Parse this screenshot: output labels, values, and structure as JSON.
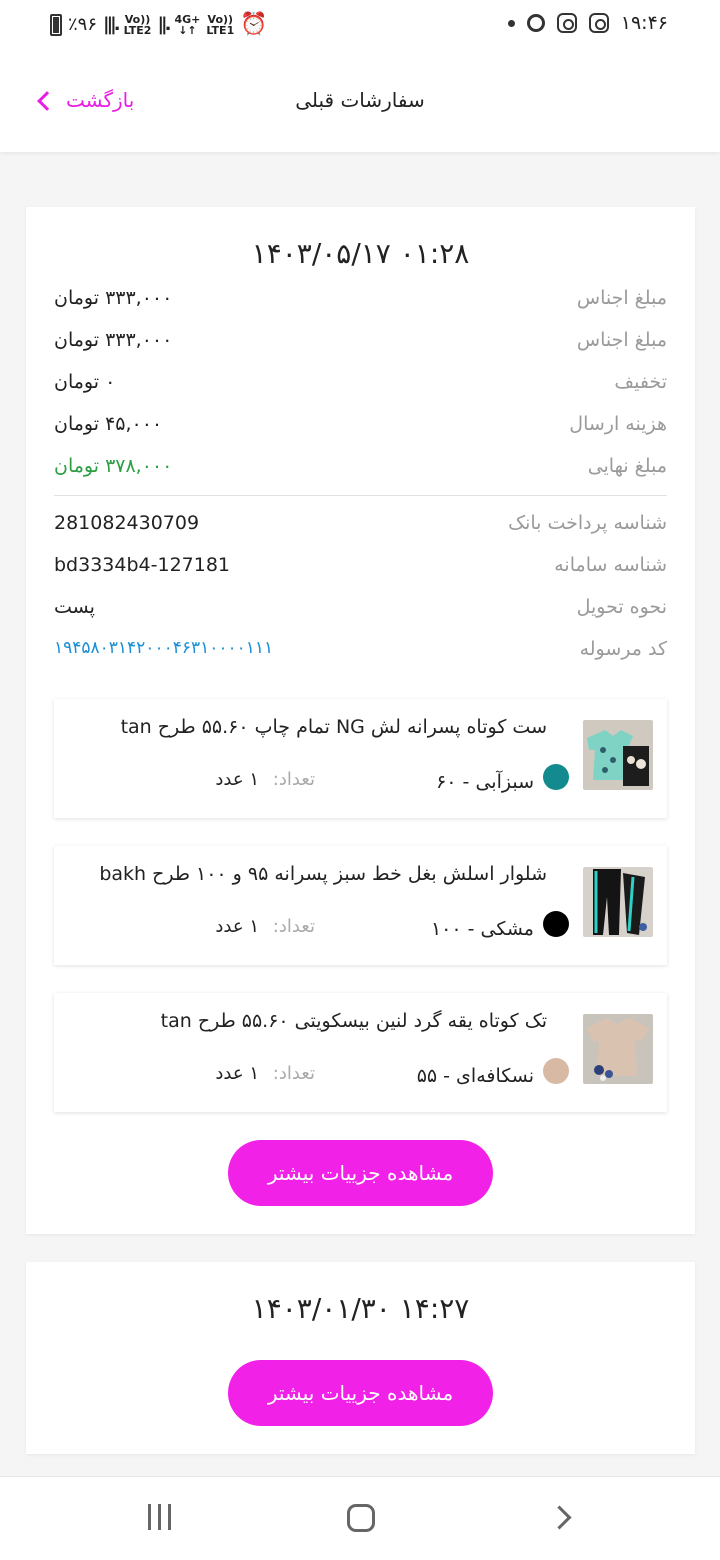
{
  "status": {
    "battery": "٪۹۶",
    "sim2": "LTE2",
    "net": "4G+",
    "sim1": "LTE1",
    "volte": "Vo))",
    "time": "۱۹:۴۶"
  },
  "header": {
    "back_label": "بازگشت",
    "title": "سفارشات قبلی"
  },
  "orders": [
    {
      "date": "۱۴۰۳/۰۵/۱۷ ۰۱:۲۸",
      "rows": [
        {
          "label": "مبلغ اجناس",
          "value": "۳۳۳,۰۰۰ تومان"
        },
        {
          "label": "مبلغ اجناس",
          "value": "۳۳۳,۰۰۰ تومان"
        },
        {
          "label": "تخفیف",
          "value": "۰ تومان"
        },
        {
          "label": "هزینه ارسال",
          "value": "۴۵,۰۰۰ تومان"
        },
        {
          "label": "مبلغ نهایی",
          "value": "۳۷۸,۰۰۰ تومان"
        },
        {
          "label": "شناسه پرداخت بانک",
          "value": "281082430709"
        },
        {
          "label": "شناسه سامانه",
          "value": "bd3334b4-127181"
        },
        {
          "label": "نحوه تحویل",
          "value": "پست"
        },
        {
          "label": "کد مرسوله",
          "value": "۱۹۴۵۸۰۳۱۴۲۰۰۰۴۶۳۱۰۰۰۰۱۱۱"
        }
      ],
      "items": [
        {
          "title": "ست کوتاه پسرانه لش NG تمام چاپ ۵۵.۶۰ طرح tan",
          "color_size": "سبزآبی  - ۶۰",
          "color": "#128a8e",
          "qty_label": "تعداد:",
          "qty": "۱ عدد"
        },
        {
          "title": "شلوار اسلش بغل خط سبز پسرانه ۹۵ و ۱۰۰ طرح bakh",
          "color_size": "مشکی  - ۱۰۰",
          "color": "#000000",
          "qty_label": "تعداد:",
          "qty": "۱ عدد"
        },
        {
          "title": "تک کوتاه یقه گرد لنین بیسکویتی ۵۵.۶۰ طرح tan",
          "color_size": "نسکافه‌ای  - ۵۵",
          "color": "#d8b9a4",
          "qty_label": "تعداد:",
          "qty": "۱ عدد"
        }
      ],
      "button": "مشاهده جزییات بیشتر"
    },
    {
      "date": "۱۴۰۳/۰۱/۳۰ ۱۴:۲۷",
      "button": "مشاهده جزییات بیشتر"
    }
  ],
  "colors": {
    "accent": "#f221e8",
    "back": "#e91ee6",
    "final_price": "#2e9e44",
    "tracking": "#1b8fd6"
  },
  "icons": [
    "battery-icon",
    "signal-icon",
    "alarm-icon",
    "instagram-icon",
    "back-chevron-icon",
    "nav-recent-icon",
    "nav-home-icon",
    "nav-back-icon"
  ]
}
